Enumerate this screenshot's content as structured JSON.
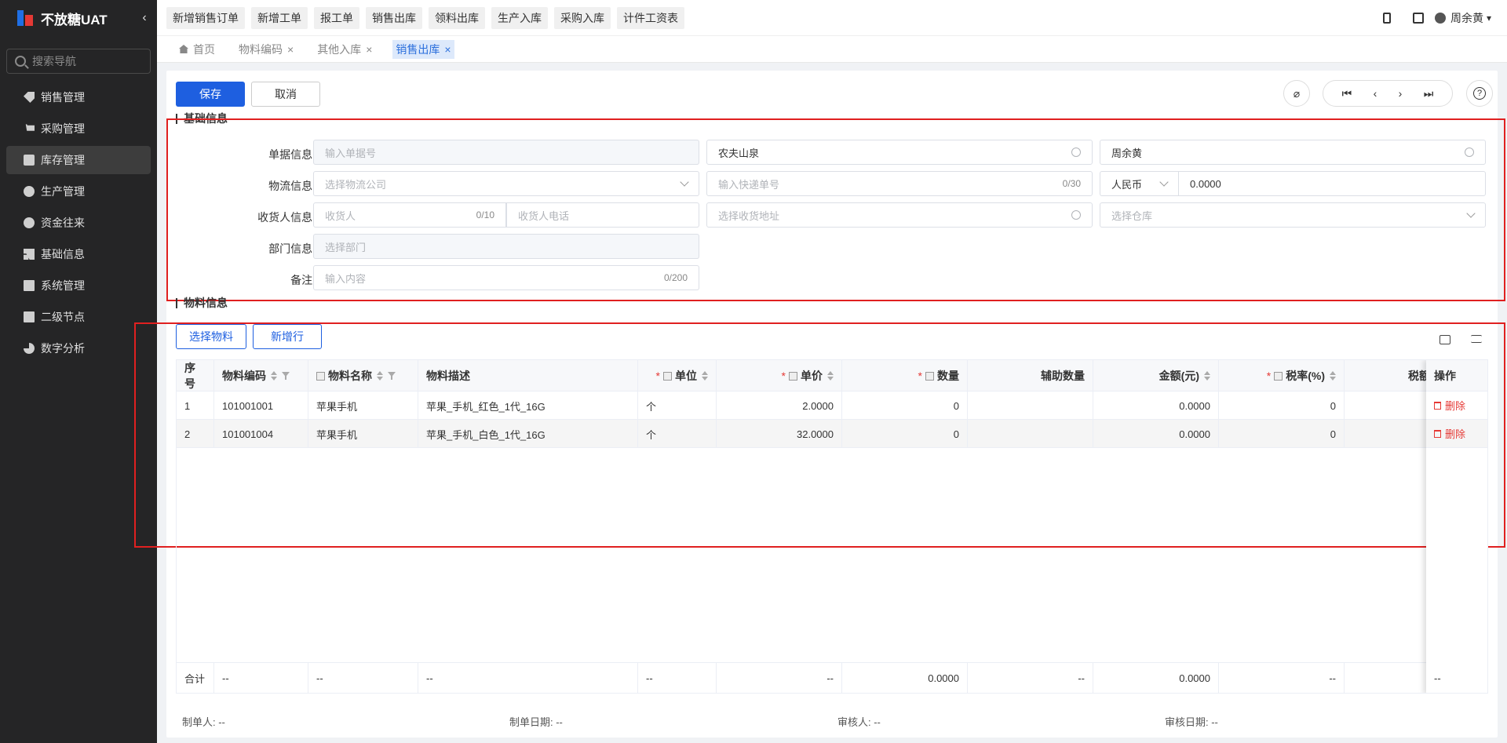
{
  "app": {
    "title": "不放糖UAT",
    "collapse_icon": "chevron-left-icon"
  },
  "sidebar": {
    "search_placeholder": "搜索导航",
    "items": [
      {
        "label": "销售管理",
        "icon": "tag-icon",
        "active": false
      },
      {
        "label": "采购管理",
        "icon": "cart-icon",
        "active": false
      },
      {
        "label": "库存管理",
        "icon": "box-icon",
        "active": true
      },
      {
        "label": "生产管理",
        "icon": "production-icon",
        "active": false
      },
      {
        "label": "资金往来",
        "icon": "money-icon",
        "active": false
      },
      {
        "label": "基础信息",
        "icon": "grid-icon",
        "active": false
      },
      {
        "label": "系统管理",
        "icon": "settings-icon",
        "active": false
      },
      {
        "label": "二级节点",
        "icon": "node-icon",
        "active": false
      },
      {
        "label": "数字分析",
        "icon": "pie-chart-icon",
        "active": false
      }
    ]
  },
  "topbar": {
    "quick_buttons": [
      "新增销售订单",
      "新增工单",
      "报工单",
      "销售出库",
      "领料出库",
      "生产入库",
      "采购入库",
      "计件工资表"
    ],
    "user_name": "周余黄"
  },
  "tabs": [
    {
      "label": "首页",
      "closable": false,
      "active": false
    },
    {
      "label": "物料编码",
      "closable": true,
      "active": false
    },
    {
      "label": "其他入库",
      "closable": true,
      "active": false
    },
    {
      "label": "销售出库",
      "closable": true,
      "active": true
    }
  ],
  "toolbar": {
    "save_label": "保存",
    "cancel_label": "取消"
  },
  "basic_info": {
    "section_title": "基础信息",
    "labels": {
      "doc": "单据信息:",
      "logistics": "物流信息:",
      "receiver": "收货人信息:",
      "dept": "部门信息:",
      "remark": "备注:"
    },
    "doc_no_placeholder": "输入单据号",
    "customer_value": "农夫山泉",
    "salesperson_value": "周余黄",
    "logistics_company_placeholder": "选择物流公司",
    "tracking_placeholder": "输入快递单号",
    "tracking_counter": "0/30",
    "currency_value": "人民币",
    "exchange_rate_value": "0.0000",
    "receiver_placeholder": "收货人",
    "receiver_counter": "0/10",
    "phone_placeholder": "收货人电话",
    "address_placeholder": "选择收货地址",
    "warehouse_placeholder": "选择仓库",
    "dept_placeholder": "选择部门",
    "remark_placeholder": "输入内容",
    "remark_counter": "0/200"
  },
  "material_info": {
    "section_title": "物料信息",
    "select_material_label": "选择物料",
    "add_row_label": "新增行",
    "columns": {
      "seq": "序号",
      "code": "物料编码",
      "name": "物料名称",
      "desc": "物料描述",
      "unit": "单位",
      "price": "单价",
      "qty": "数量",
      "aux_qty": "辅助数量",
      "amount": "金额(元)",
      "tax_rate": "税率(%)",
      "tax": "税额",
      "op": "操作"
    },
    "rows": [
      {
        "seq": "1",
        "code": "101001001",
        "name": "苹果手机",
        "desc": "苹果_手机_红色_1代_16G",
        "unit": "个",
        "price": "2.0000",
        "qty": "0",
        "aux_qty": "",
        "amount": "0.0000",
        "tax_rate": "0",
        "op": "删除"
      },
      {
        "seq": "2",
        "code": "101001004",
        "name": "苹果手机",
        "desc": "苹果_手机_白色_1代_16G",
        "unit": "个",
        "price": "32.0000",
        "qty": "0",
        "aux_qty": "",
        "amount": "0.0000",
        "tax_rate": "0",
        "op": "删除"
      }
    ],
    "footer": {
      "label": "合计",
      "code": "--",
      "name": "--",
      "desc": "--",
      "unit": "--",
      "price": "--",
      "qty": "0.0000",
      "aux_qty": "--",
      "amount": "0.0000",
      "tax_rate": "--",
      "op": "--"
    }
  },
  "meta": {
    "creator": "制单人: --",
    "create_date": "制单日期: --",
    "auditor": "审核人: --",
    "audit_date": "审核日期: --"
  }
}
